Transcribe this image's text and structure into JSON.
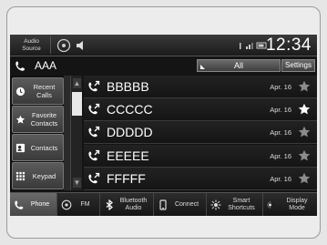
{
  "status": {
    "audio_source": "Audio\nSource",
    "clock": "12:34"
  },
  "header": {
    "contact_name": "AAA",
    "filter_tab": "All",
    "settings_label": "Settings"
  },
  "left_nav": [
    {
      "label": "Recent\nCalls",
      "icon": "clock-icon"
    },
    {
      "label": "Favorite\nContacts",
      "icon": "star-icon"
    },
    {
      "label": "Contacts",
      "icon": "contact-card-icon"
    },
    {
      "label": "Keypad",
      "icon": "keypad-icon"
    }
  ],
  "calls": [
    {
      "name": "BBBBB",
      "date": "Apr. 16",
      "favorite": false
    },
    {
      "name": "CCCCC",
      "date": "Apr. 16",
      "favorite": true
    },
    {
      "name": "DDDDD",
      "date": "Apr. 16",
      "favorite": false
    },
    {
      "name": "EEEEE",
      "date": "Apr. 16",
      "favorite": false
    },
    {
      "name": "FFFFF",
      "date": "Apr. 16",
      "favorite": false
    }
  ],
  "bottom_bar": [
    {
      "label": "Phone",
      "icon": "phone-icon",
      "active": true
    },
    {
      "label": "FM",
      "icon": "radio-icon",
      "active": false
    },
    {
      "label": "Bluetooth\nAudio",
      "icon": "bluetooth-icon",
      "active": false
    },
    {
      "label": "Connect",
      "icon": "smartphone-icon",
      "active": false
    },
    {
      "label": "Smart\nShortcuts",
      "icon": "shortcuts-icon",
      "active": false
    },
    {
      "label": "Display\nMode",
      "icon": "display-mode-icon",
      "active": false
    }
  ],
  "colors": {
    "star_active": "#ffffff",
    "star_inactive": "#8c8c8c"
  }
}
